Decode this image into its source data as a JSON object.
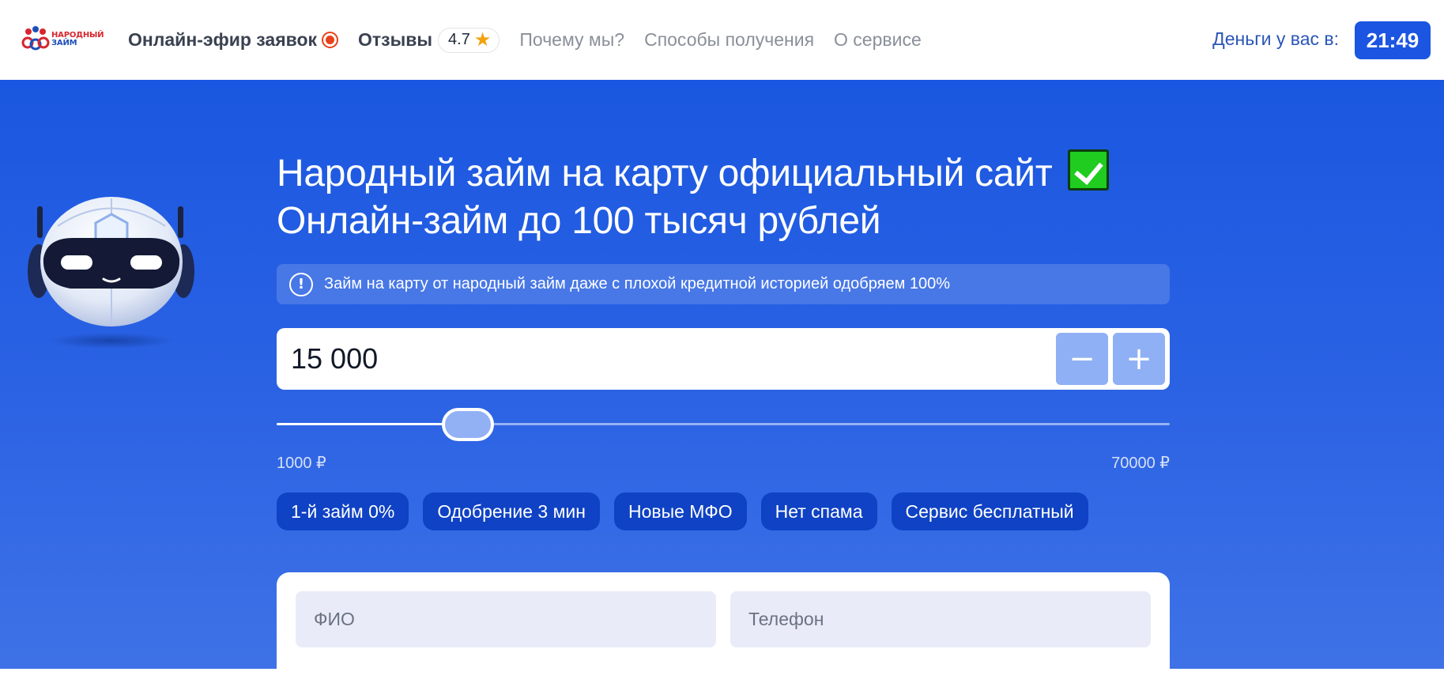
{
  "header": {
    "logo": {
      "line1": "Народный",
      "line2": "займ"
    },
    "nav": [
      {
        "label": "Онлайн-эфир заявок",
        "strong": true
      },
      {
        "label": "Отзывы",
        "strong": true
      },
      {
        "label": "Почему мы?"
      },
      {
        "label": "Способы получения"
      },
      {
        "label": "О сервисе"
      }
    ],
    "rating": "4.7",
    "money_label": "Деньги у вас в:",
    "timer": "21:49"
  },
  "hero": {
    "title_line1": "Народный займ на карту официальный сайт",
    "title_line2": "Онлайн-займ до 100 тысяч рублей",
    "notice": "Займ на карту от народный займ даже с плохой кредитной историей одобряем 100%",
    "amount": {
      "value": "15 000",
      "minus": "−",
      "plus": "+"
    },
    "slider": {
      "min": 1000,
      "max": 70000,
      "value": 15000,
      "min_label": "1000 ₽",
      "max_label": "70000 ₽"
    },
    "chips": [
      "1-й займ 0%",
      "Одобрение 3 мин",
      "Новые МФО",
      "Нет спама",
      "Сервис бесплатный"
    ]
  },
  "form": {
    "fio_placeholder": "ФИО",
    "phone_placeholder": "Телефон"
  }
}
